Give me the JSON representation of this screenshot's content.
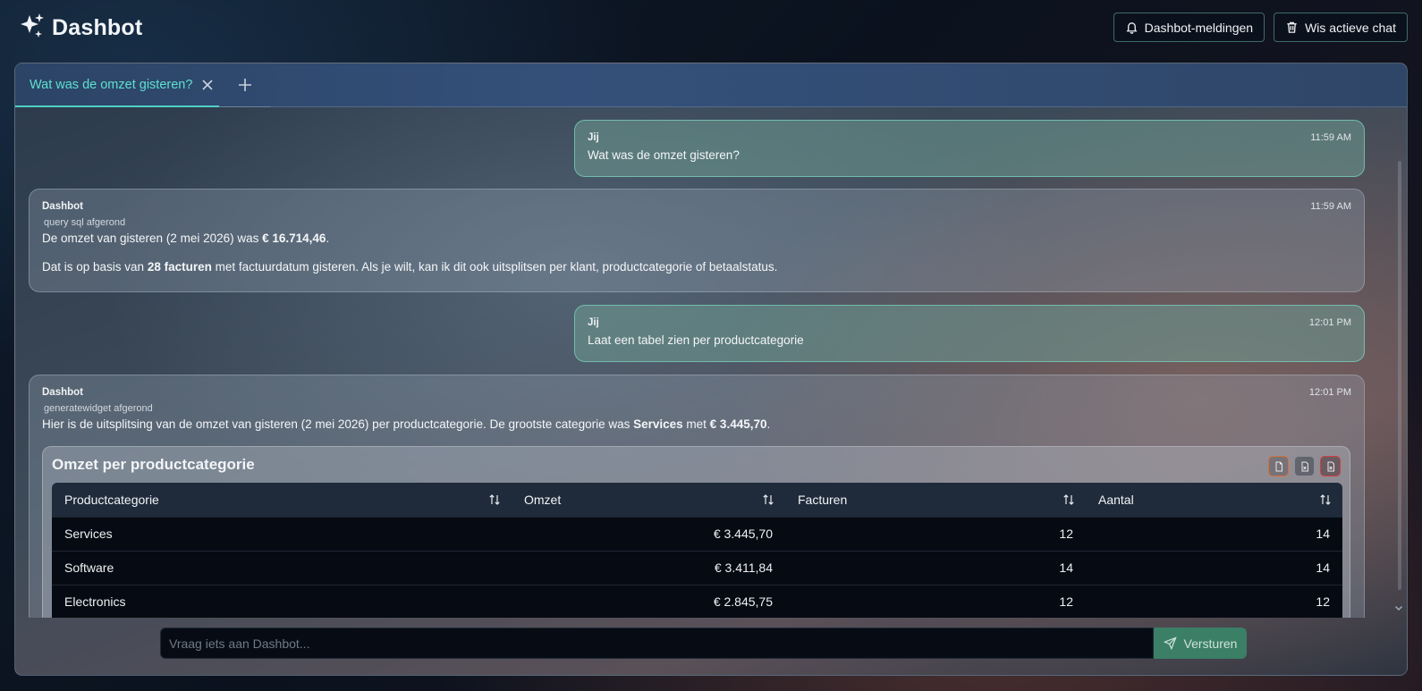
{
  "app": {
    "name": "Dashbot"
  },
  "header": {
    "notifications_label": "Dashbot-meldingen",
    "clear_chat_label": "Wis actieve chat"
  },
  "tabs": [
    {
      "label": "Wat was de omzet gisteren?",
      "active": true
    }
  ],
  "messages": [
    {
      "author": "Jij",
      "time": "11:59 AM",
      "text": "Wat was de omzet gisteren?"
    },
    {
      "author": "Dashbot",
      "time": "11:59 AM",
      "tool_status": "query sql afgerond",
      "p1_prefix": "De omzet van gisteren (2 mei 2026) was ",
      "p1_bold": "€ 16.714,46",
      "p1_suffix": ".",
      "p2_prefix": "Dat is op basis van ",
      "p2_bold": "28 facturen",
      "p2_suffix": " met factuurdatum gisteren. Als je wilt, kan ik dit ook uitsplitsen per klant, productcategorie of betaalstatus."
    },
    {
      "author": "Jij",
      "time": "12:01 PM",
      "text": "Laat een tabel zien per productcategorie"
    },
    {
      "author": "Dashbot",
      "time": "12:01 PM",
      "tool_status": "generatewidget afgerond",
      "p1_prefix": "Hier is de uitsplitsing van de omzet van gisteren (2 mei 2026) per productcategorie. De grootste categorie was ",
      "p1_bold": "Services",
      "p1_mid": " met ",
      "p1_bold2": "€ 3.445,70",
      "p1_suffix": "."
    }
  ],
  "widget": {
    "title": "Omzet per productcategorie",
    "columns": [
      "Productcategorie",
      "Omzet",
      "Facturen",
      "Aantal"
    ],
    "rows": [
      [
        "Services",
        "€ 3.445,70",
        "12",
        "14"
      ],
      [
        "Software",
        "€ 3.411,84",
        "14",
        "14"
      ],
      [
        "Electronics",
        "€ 2.845,75",
        "12",
        "12"
      ]
    ]
  },
  "composer": {
    "placeholder": "Vraag iets aan Dashbot...",
    "send_label": "Versturen"
  },
  "icons": {
    "brand": "sparkles-icon",
    "notifications": "bell-icon",
    "clear": "trash-icon",
    "tab_close": "close-icon",
    "tab_add": "plus-icon",
    "sort": "sort-icon",
    "send": "send-icon",
    "export": [
      "file-pdf-icon",
      "file-csv-icon",
      "file-excel-icon"
    ]
  },
  "colors": {
    "accent": "#4fd1c5",
    "send_button": "#3a7f66",
    "user_bubble_border": "#78d2be"
  }
}
